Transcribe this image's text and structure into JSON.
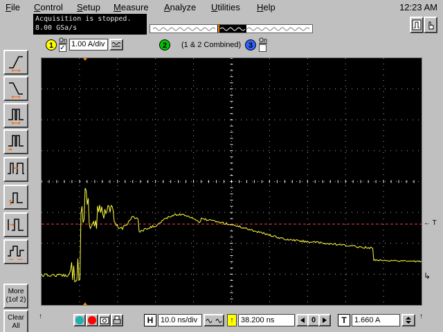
{
  "menu": {
    "items": [
      {
        "first": "F",
        "rest": "ile"
      },
      {
        "first": "C",
        "rest": "ontrol"
      },
      {
        "first": "S",
        "rest": "etup"
      },
      {
        "first": "M",
        "rest": "easure"
      },
      {
        "first": "A",
        "rest": "nalyze"
      },
      {
        "first": "U",
        "rest": "tilities"
      },
      {
        "first": "H",
        "rest": "elp"
      }
    ],
    "clock": "12:23 AM"
  },
  "status": {
    "line1": "Acquisition is stopped.",
    "line2": "8.00 GSa/s"
  },
  "channels": {
    "ch1": {
      "number": "1",
      "on_label": "On",
      "checked": "✓",
      "scale": "1.00 A/div",
      "color": "#ffff00"
    },
    "ch2": {
      "number": "2",
      "label": "(1 & 2 Combined)",
      "color": "#00c000"
    },
    "ch3": {
      "number": "3",
      "on_label": "On",
      "color": "#3060ff"
    }
  },
  "sidebar": {
    "more_line1": "More",
    "more_line2": "(1of 2)",
    "clear_line1": "Clear",
    "clear_line2": "All"
  },
  "screen": {
    "trigger_marker": "T",
    "trigger_level_color": "#ff4040",
    "trace_color": "#ffff40",
    "grid_color": "#ffffff"
  },
  "timebase": {
    "h_label": "H",
    "scale": "10.0 ns/div",
    "delay": "38.200 ns",
    "zero": "0"
  },
  "trigger": {
    "t_label": "T",
    "level": "1.660 A"
  }
}
